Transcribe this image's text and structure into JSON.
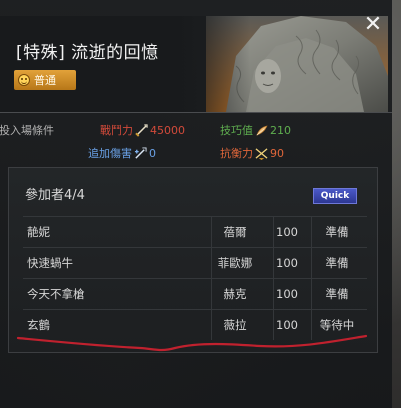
{
  "dialog": {
    "title": "[特殊] 流逝的回憶",
    "close_glyph": "✕",
    "mode_badge": "普通"
  },
  "stats": {
    "entry_condition_label": "可投入場條件",
    "combat_power_label": "戰鬥力",
    "combat_power_value": "45000",
    "skill_value_label": "技巧值",
    "skill_value": "210",
    "extra_damage_label": "追加傷害",
    "extra_damage_value": "0",
    "resistance_label": "抗衡力",
    "resistance_value": "90"
  },
  "party": {
    "title": "參加者4/4",
    "quick_label": "Quick",
    "members": [
      {
        "name": "靘妮",
        "class": "蓓爾",
        "level": "100",
        "status": "準備"
      },
      {
        "name": "快速蝸牛",
        "class": "菲歐娜",
        "level": "100",
        "status": "準備"
      },
      {
        "name": "今天不拿槍",
        "class": "赫克",
        "level": "100",
        "status": "準備"
      },
      {
        "name": "玄鶴",
        "class": "薇拉",
        "level": "100",
        "status": "等待中"
      }
    ]
  },
  "colors": {
    "combat_power": "#d24a3a",
    "skill_value": "#5fae4f",
    "extra_damage": "#6aa1e6",
    "resistance": "#e0663a",
    "quick_button": "#3b47b0",
    "mode_badge": "#d08e28",
    "annotation_line": "#c0212e"
  },
  "icons": {
    "close": "close-icon",
    "mode": "smile-face-icon",
    "combat_power": "crossed-swords-icon",
    "skill_value": "feather-icon",
    "extra_damage": "sword-plus-icon",
    "resistance": "shield-swords-icon"
  }
}
